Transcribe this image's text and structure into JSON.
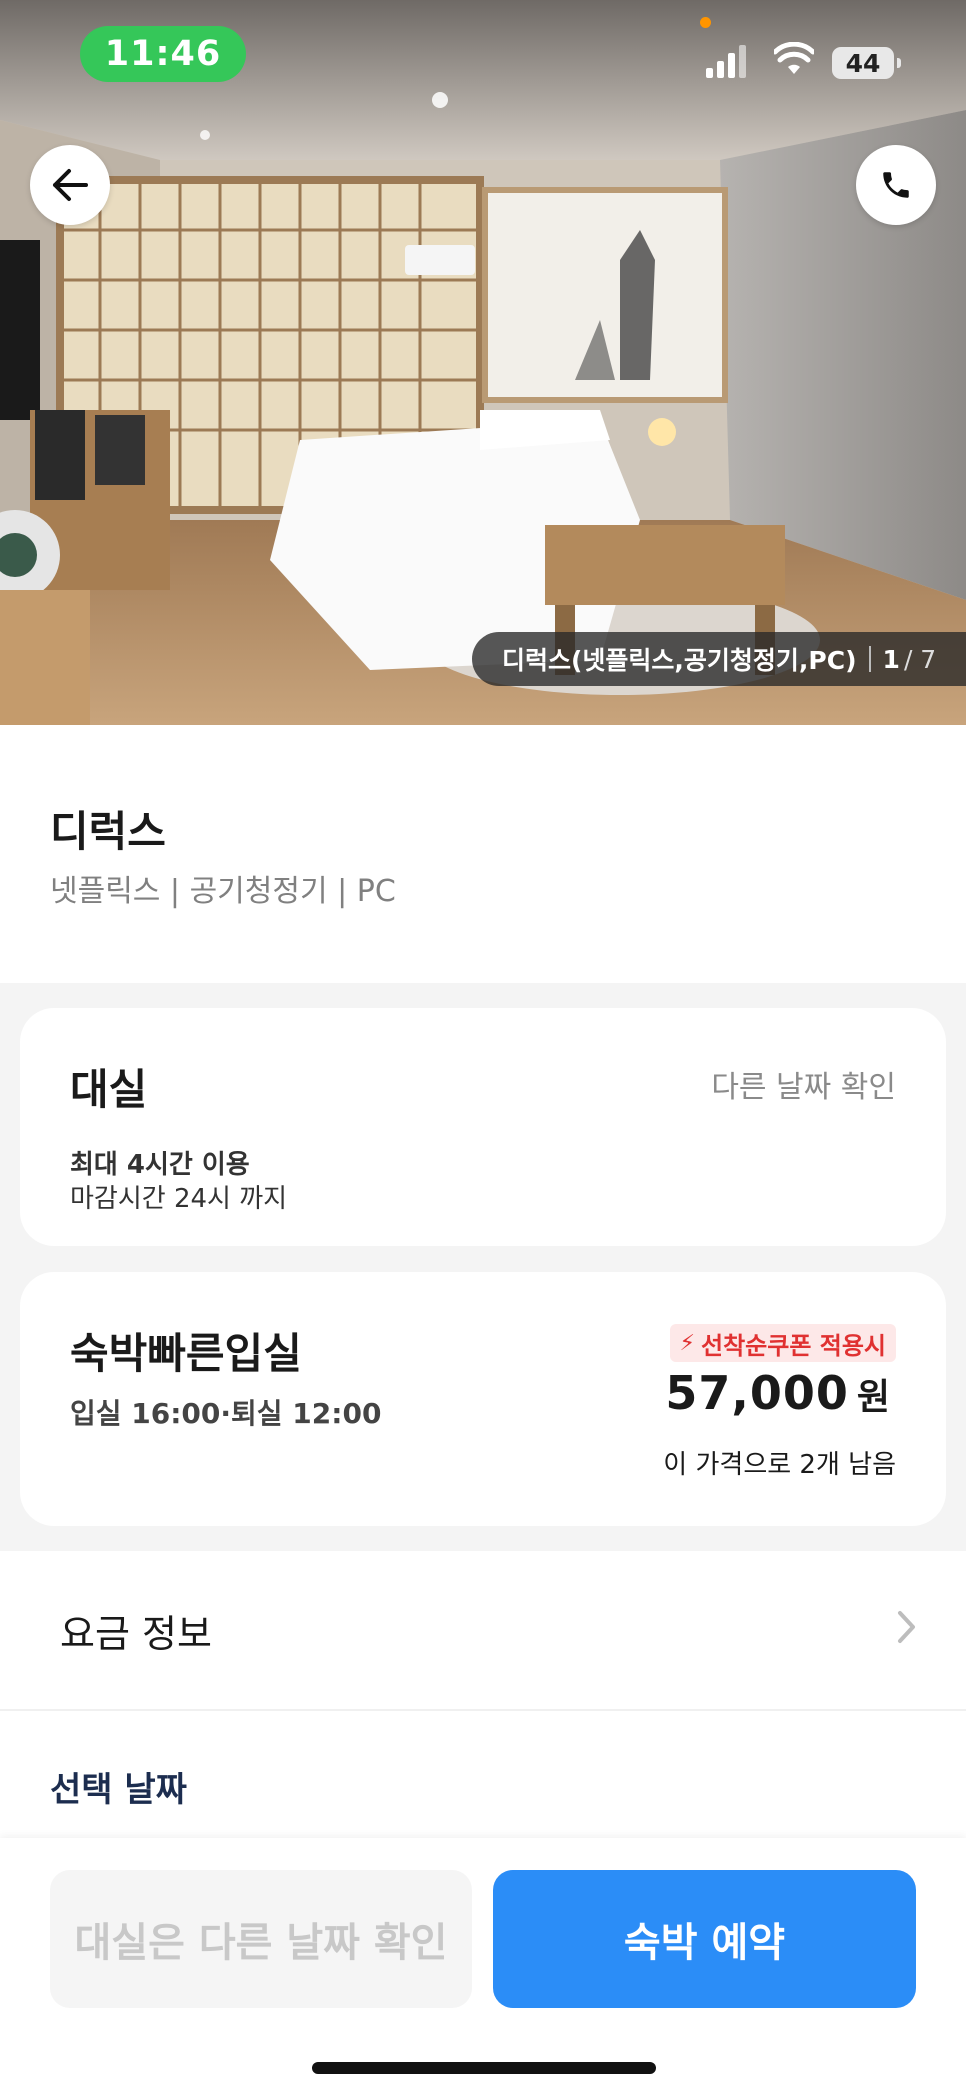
{
  "status_bar": {
    "time": "11:46",
    "battery": "44"
  },
  "hero": {
    "caption": "디럭스(넷플릭스,공기청정기,PC)",
    "current": "1",
    "total": "/ 7"
  },
  "room": {
    "title": "디럭스",
    "tags": "넷플릭스 | 공기청정기 | PC"
  },
  "daystay": {
    "title": "대실",
    "other_date_link": "다른 날짜 확인",
    "line1": "최대 4시간 이용",
    "line2": "마감시간 24시 까지"
  },
  "overnight": {
    "title": "숙박빠른입실",
    "times": "입실 16:00·퇴실 12:00",
    "coupon_label": "선착순쿠폰 적용시",
    "price": "57,000",
    "currency": "원",
    "remaining": "이 가격으로 2개 남음"
  },
  "rate_info": {
    "label": "요금 정보"
  },
  "selected_date": {
    "label": "선택 날짜"
  },
  "bottom": {
    "disabled_label": "대실은 다른 날짜 확인",
    "primary_label": "숙박 예약"
  },
  "colors": {
    "accent": "#2b8df7",
    "status_green": "#35c759",
    "coupon_red": "#e03131",
    "heading_navy": "#1c2d4f"
  },
  "icons": [
    "back-arrow-icon",
    "phone-icon",
    "lightning-icon",
    "chevron-right-icon",
    "cellular-signal-icon",
    "wifi-icon"
  ]
}
